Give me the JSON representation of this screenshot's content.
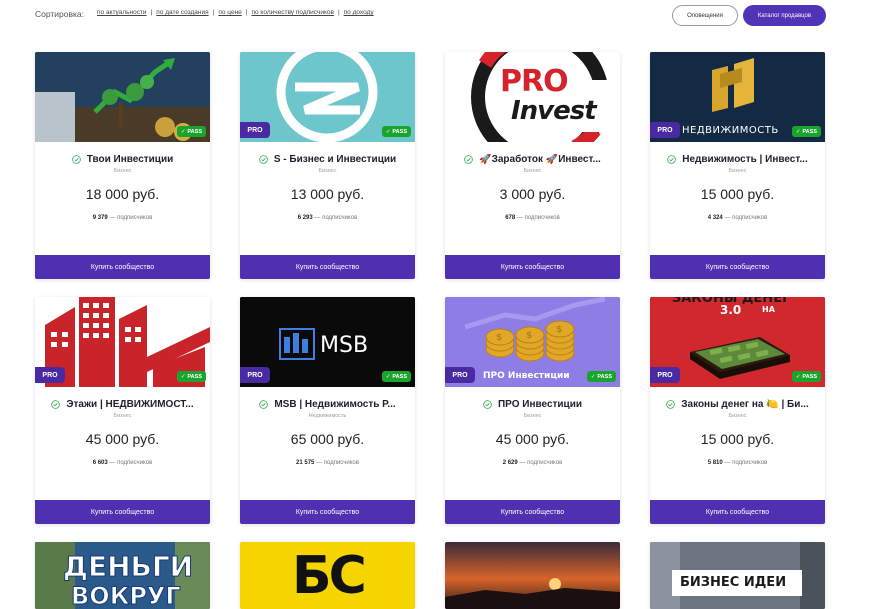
{
  "sort": {
    "label": "Сортировка:",
    "links": [
      "по актуальности",
      "по дате создания",
      "по цене",
      "по количеству подписчиков",
      "по доходу"
    ]
  },
  "header": {
    "notify_label": "Оповещения",
    "catalog_label": "Каталог продавцов"
  },
  "colors": {
    "accent": "#4e30b0",
    "pass": "#19a52c",
    "pro": "#4a2aa3"
  },
  "card_button_label": "Купить сообщество",
  "subs_suffix": "— подписчиков",
  "cards": [
    {
      "title": "Твои Инвестиции",
      "category": "Бизнес",
      "price": "18 000",
      "currency": "руб.",
      "subs": "9 379",
      "pro": false,
      "pass": "PASS"
    },
    {
      "title": "S - Бизнес и Инвестиции",
      "category": "Бизнес",
      "price": "13 000",
      "currency": "руб.",
      "subs": "6 293",
      "pro": "PRO",
      "pass": "PASS"
    },
    {
      "title": "🚀Заработок 🚀Инвест...",
      "category": "Бизнес",
      "price": "3 000",
      "currency": "руб.",
      "subs": "678",
      "pro": false,
      "pass": false,
      "logo": [
        "PRO",
        "Invest"
      ]
    },
    {
      "title": "Недвижимость | Инвест...",
      "category": "Бизнес",
      "price": "15 000",
      "currency": "руб.",
      "subs": "4 324",
      "pro": "PRO",
      "pass": "PASS",
      "logo": [
        "НЕДВИЖИМОСТЬ"
      ]
    },
    {
      "title": "Этажи | НЕДВИЖИМОСТ...",
      "category": "Бизнес",
      "price": "45 000",
      "currency": "руб.",
      "subs": "6 603",
      "pro": "PRO",
      "pass": "PASS"
    },
    {
      "title": "MSB | Недвижимость Р...",
      "category": "Недвижимость",
      "price": "65 000",
      "currency": "руб.",
      "subs": "21 575",
      "pro": "PRO",
      "pass": "PASS",
      "logo": [
        "MSB"
      ]
    },
    {
      "title": "ПРО Инвестиции",
      "category": "Бизнес",
      "price": "45 000",
      "currency": "руб.",
      "subs": "2 629",
      "pro": "PRO",
      "pass": "PASS",
      "logo": [
        "ПРО Инвестиции"
      ]
    },
    {
      "title": "Законы денег на 🍋 | Би...",
      "category": "Бизнес",
      "price": "15 000",
      "currency": "руб.",
      "subs": "5 810",
      "pro": "PRO",
      "pass": "PASS",
      "logo": [
        "ЗАКОНЫ ДЕНЕГ",
        "3.0",
        "НА"
      ]
    },
    {
      "logo": [
        "ДЕНЬГИ",
        "ВОКРУГ"
      ]
    },
    {
      "logo": [
        "БС"
      ]
    },
    {},
    {
      "logo": [
        "БИЗНЕС ИДЕИ"
      ]
    }
  ]
}
